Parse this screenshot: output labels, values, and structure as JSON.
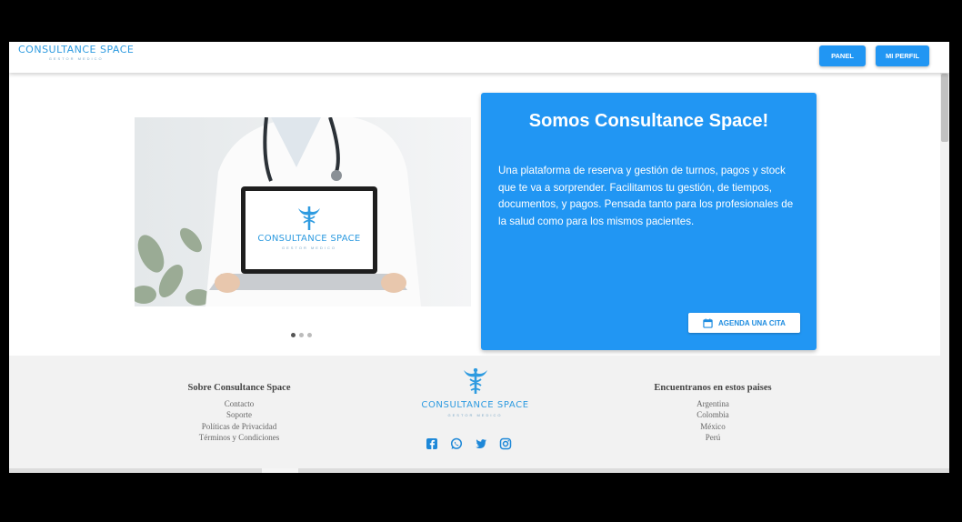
{
  "header": {
    "logo_text": "CONSULTANCE SPACE",
    "logo_sub": "GESTOR MEDICO",
    "panel_label": "PANEL",
    "perfil_label": "MI PERFIL"
  },
  "carousel": {
    "screen_logo_text": "CONSULTANCE SPACE",
    "screen_logo_sub": "GESTOR MEDICO",
    "dots": [
      true,
      false,
      false
    ]
  },
  "hero": {
    "title": "Somos Consultance Space!",
    "description": "Una plataforma de reserva y gestión de turnos, pagos y stock que te va a sorprender. Facilitamos tu gestión, de tiempos, documentos, y pagos. Pensada tanto para los profesionales de la salud como para los mismos pacientes.",
    "cta_label": "AGENDA UNA CITA"
  },
  "footer": {
    "about": {
      "heading": "Sobre Consultance Space",
      "links": [
        "Contacto",
        "Soporte",
        "Políticas de Privacidad",
        "Términos y Condiciones"
      ]
    },
    "logo_text": "CONSULTANCE SPACE",
    "logo_sub": "GESTOR MEDICO",
    "countries": {
      "heading": "Encuentranos en estos paises",
      "items": [
        "Argentina",
        "Colombia",
        "México",
        "Perú"
      ]
    },
    "social_icons": [
      "facebook-icon",
      "whatsapp-icon",
      "twitter-icon",
      "instagram-icon"
    ]
  },
  "colors": {
    "primary": "#2196f3",
    "logo": "#2e9be0",
    "footer_bg": "#f2f2f2"
  }
}
